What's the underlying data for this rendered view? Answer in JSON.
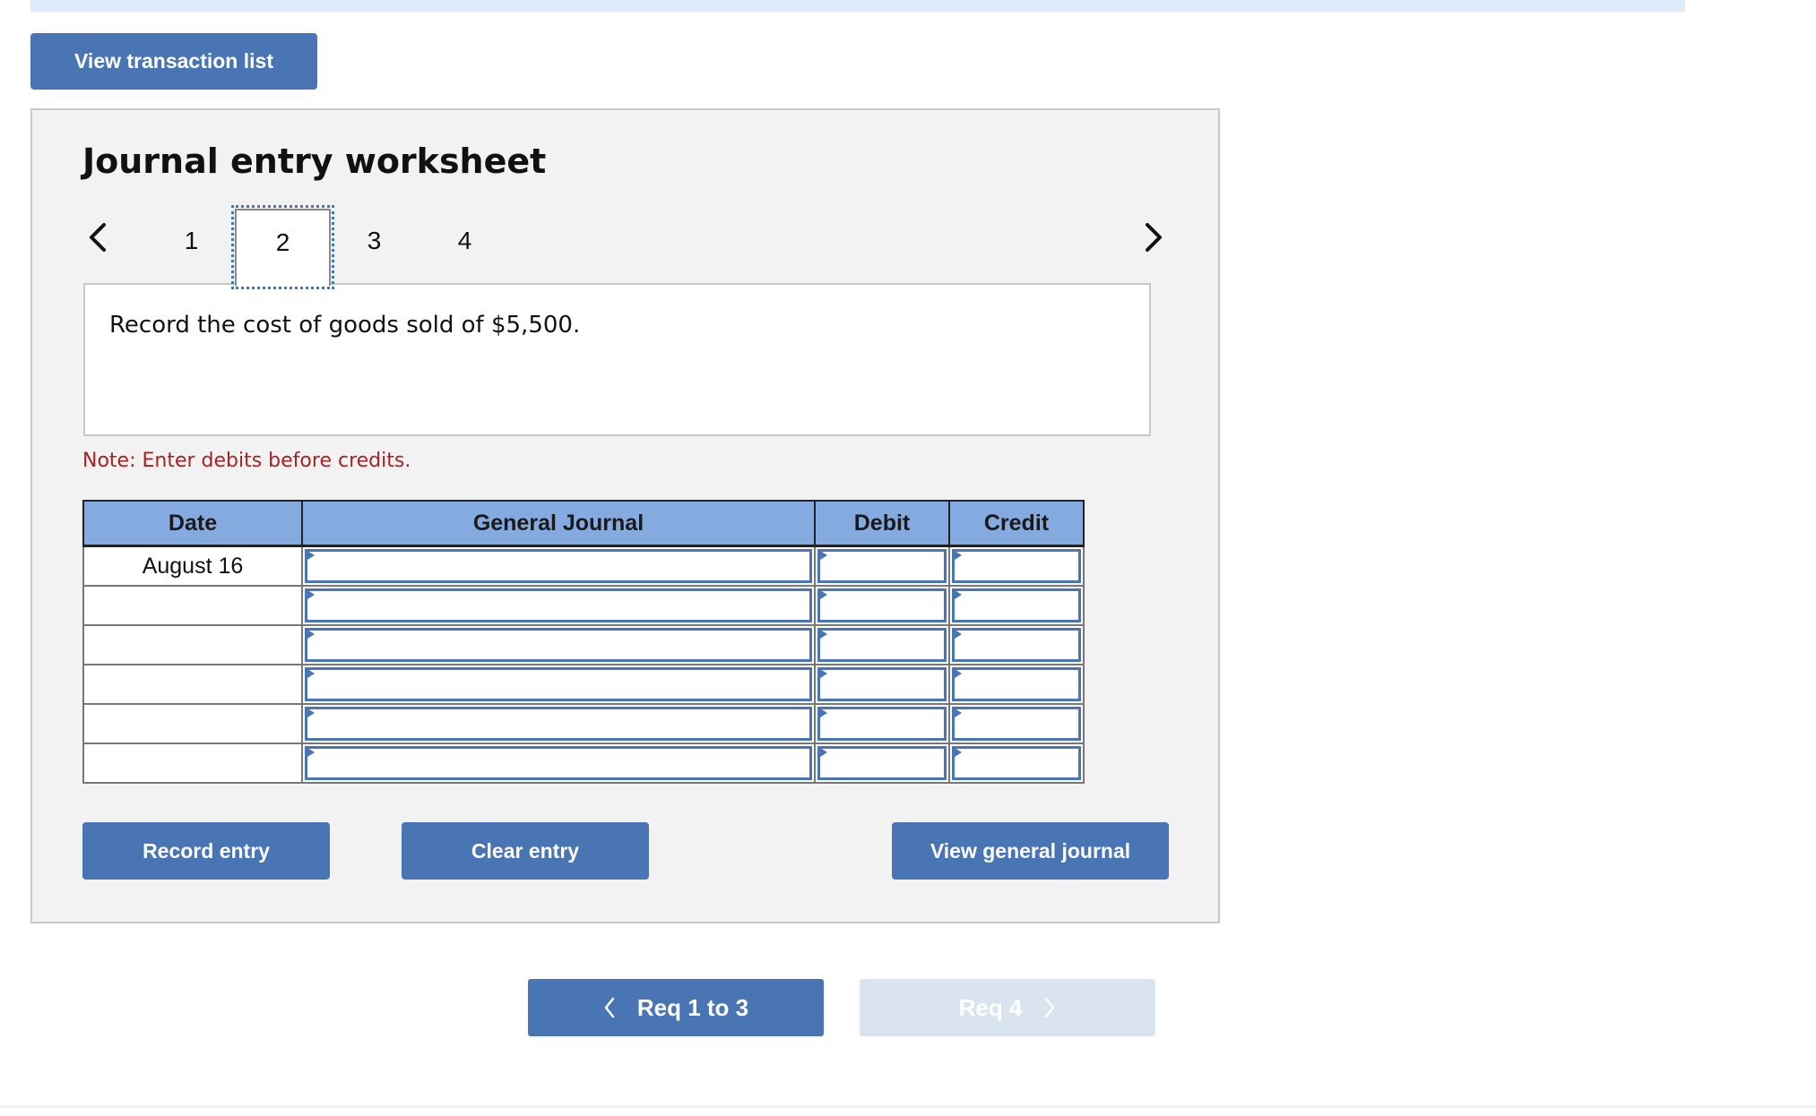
{
  "header": {
    "view_transactions_label": "View transaction list"
  },
  "worksheet": {
    "title": "Journal entry worksheet",
    "tabs": [
      {
        "label": "1",
        "active": false
      },
      {
        "label": "2",
        "active": true
      },
      {
        "label": "3",
        "active": false
      },
      {
        "label": "4",
        "active": false
      }
    ],
    "prev_icon": "chevron-left-icon",
    "next_icon": "chevron-right-icon",
    "description": "Record the cost of goods sold of $5,500.",
    "note": "Note: Enter debits before credits.",
    "note_color": "#a52323",
    "table": {
      "columns": [
        "Date",
        "General Journal",
        "Debit",
        "Credit"
      ],
      "rows": [
        {
          "date": "August 16",
          "account": "",
          "debit": "",
          "credit": ""
        },
        {
          "date": "",
          "account": "",
          "debit": "",
          "credit": ""
        },
        {
          "date": "",
          "account": "",
          "debit": "",
          "credit": ""
        },
        {
          "date": "",
          "account": "",
          "debit": "",
          "credit": ""
        },
        {
          "date": "",
          "account": "",
          "debit": "",
          "credit": ""
        },
        {
          "date": "",
          "account": "",
          "debit": "",
          "credit": ""
        }
      ]
    },
    "buttons": {
      "record": "Record entry",
      "clear": "Clear entry",
      "view_general_journal": "View general journal"
    }
  },
  "footer_nav": {
    "prev_label": "Req 1 to 3",
    "next_label": "Req 4",
    "next_disabled": true
  },
  "colors": {
    "accent": "#4a75b4",
    "header_fill": "#84aadf",
    "panel_bg": "#f2f2f2",
    "disabled_button": "#dae4f0",
    "topbar": "#ddeaf7"
  }
}
